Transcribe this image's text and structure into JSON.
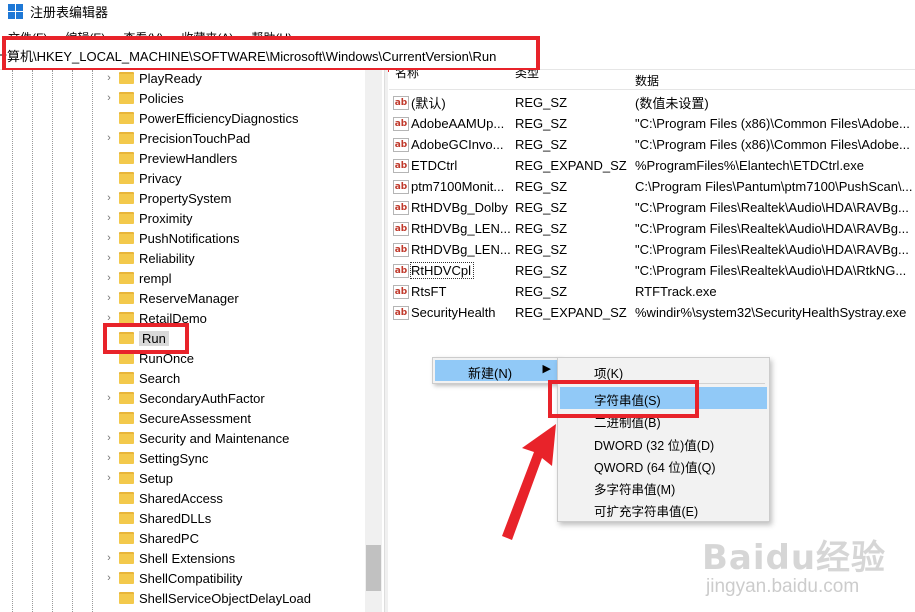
{
  "window": {
    "title": "注册表编辑器"
  },
  "menubar": [
    "文件(F)",
    "编辑(E)",
    "查看(V)",
    "收藏夹(A)",
    "帮助(H)"
  ],
  "address": {
    "path": "计算机\\HKEY_LOCAL_MACHINE\\SOFTWARE\\Microsoft\\Windows\\CurrentVersion\\Run"
  },
  "tree": {
    "items": [
      {
        "label": "PlayReady",
        "expandable": true
      },
      {
        "label": "Policies",
        "expandable": true
      },
      {
        "label": "PowerEfficiencyDiagnostics",
        "expandable": false
      },
      {
        "label": "PrecisionTouchPad",
        "expandable": true
      },
      {
        "label": "PreviewHandlers",
        "expandable": false
      },
      {
        "label": "Privacy",
        "expandable": false
      },
      {
        "label": "PropertySystem",
        "expandable": true
      },
      {
        "label": "Proximity",
        "expandable": true
      },
      {
        "label": "PushNotifications",
        "expandable": true
      },
      {
        "label": "Reliability",
        "expandable": true
      },
      {
        "label": "rempl",
        "expandable": true
      },
      {
        "label": "ReserveManager",
        "expandable": true
      },
      {
        "label": "RetailDemo",
        "expandable": true
      },
      {
        "label": "Run",
        "expandable": false,
        "selected": true
      },
      {
        "label": "RunOnce",
        "expandable": false
      },
      {
        "label": "Search",
        "expandable": false
      },
      {
        "label": "SecondaryAuthFactor",
        "expandable": true
      },
      {
        "label": "SecureAssessment",
        "expandable": false
      },
      {
        "label": "Security and Maintenance",
        "expandable": true
      },
      {
        "label": "SettingSync",
        "expandable": true
      },
      {
        "label": "Setup",
        "expandable": true
      },
      {
        "label": "SharedAccess",
        "expandable": false
      },
      {
        "label": "SharedDLLs",
        "expandable": false
      },
      {
        "label": "SharedPC",
        "expandable": false
      },
      {
        "label": "Shell Extensions",
        "expandable": true
      },
      {
        "label": "ShellCompatibility",
        "expandable": true
      },
      {
        "label": "ShellServiceObjectDelayLoad",
        "expandable": false
      }
    ]
  },
  "values": {
    "columns": {
      "name": "名称",
      "type": "类型",
      "data": "数据"
    },
    "rows": [
      {
        "name": "(默认)",
        "type": "REG_SZ",
        "data": "(数值未设置)"
      },
      {
        "name": "AdobeAAMUp...",
        "type": "REG_SZ",
        "data": "\"C:\\Program Files (x86)\\Common Files\\Adobe..."
      },
      {
        "name": "AdobeGCInvo...",
        "type": "REG_SZ",
        "data": "\"C:\\Program Files (x86)\\Common Files\\Adobe..."
      },
      {
        "name": "ETDCtrl",
        "type": "REG_EXPAND_SZ",
        "data": "%ProgramFiles%\\Elantech\\ETDCtrl.exe"
      },
      {
        "name": "ptm7100Monit...",
        "type": "REG_SZ",
        "data": "C:\\Program Files\\Pantum\\ptm7100\\PushScan\\..."
      },
      {
        "name": "RtHDVBg_Dolby",
        "type": "REG_SZ",
        "data": "\"C:\\Program Files\\Realtek\\Audio\\HDA\\RAVBg..."
      },
      {
        "name": "RtHDVBg_LEN...",
        "type": "REG_SZ",
        "data": "\"C:\\Program Files\\Realtek\\Audio\\HDA\\RAVBg..."
      },
      {
        "name": "RtHDVBg_LEN...",
        "type": "REG_SZ",
        "data": "\"C:\\Program Files\\Realtek\\Audio\\HDA\\RAVBg..."
      },
      {
        "name": "RtHDVCpl",
        "type": "REG_SZ",
        "data": "\"C:\\Program Files\\Realtek\\Audio\\HDA\\RtkNG...",
        "focused": true
      },
      {
        "name": "RtsFT",
        "type": "REG_SZ",
        "data": "RTFTrack.exe"
      },
      {
        "name": "SecurityHealth",
        "type": "REG_EXPAND_SZ",
        "data": "%windir%\\system32\\SecurityHealthSystray.exe"
      }
    ]
  },
  "context_menu": {
    "new_label": "新建(N)",
    "arrow": "▶"
  },
  "submenu": {
    "items": [
      "项(K)",
      "字符串值(S)",
      "二进制值(B)",
      "DWORD (32 位)值(D)",
      "QWORD (64 位)值(Q)",
      "多字符串值(M)",
      "可扩充字符串值(E)"
    ],
    "hovered_index": 1
  },
  "watermark": {
    "brand": "Baidu经验",
    "url": "jingyan.baidu.com"
  },
  "colors": {
    "annotation_red": "#e8232a",
    "menu_highlight": "#91c9f7",
    "folder": "#f3c94c"
  }
}
